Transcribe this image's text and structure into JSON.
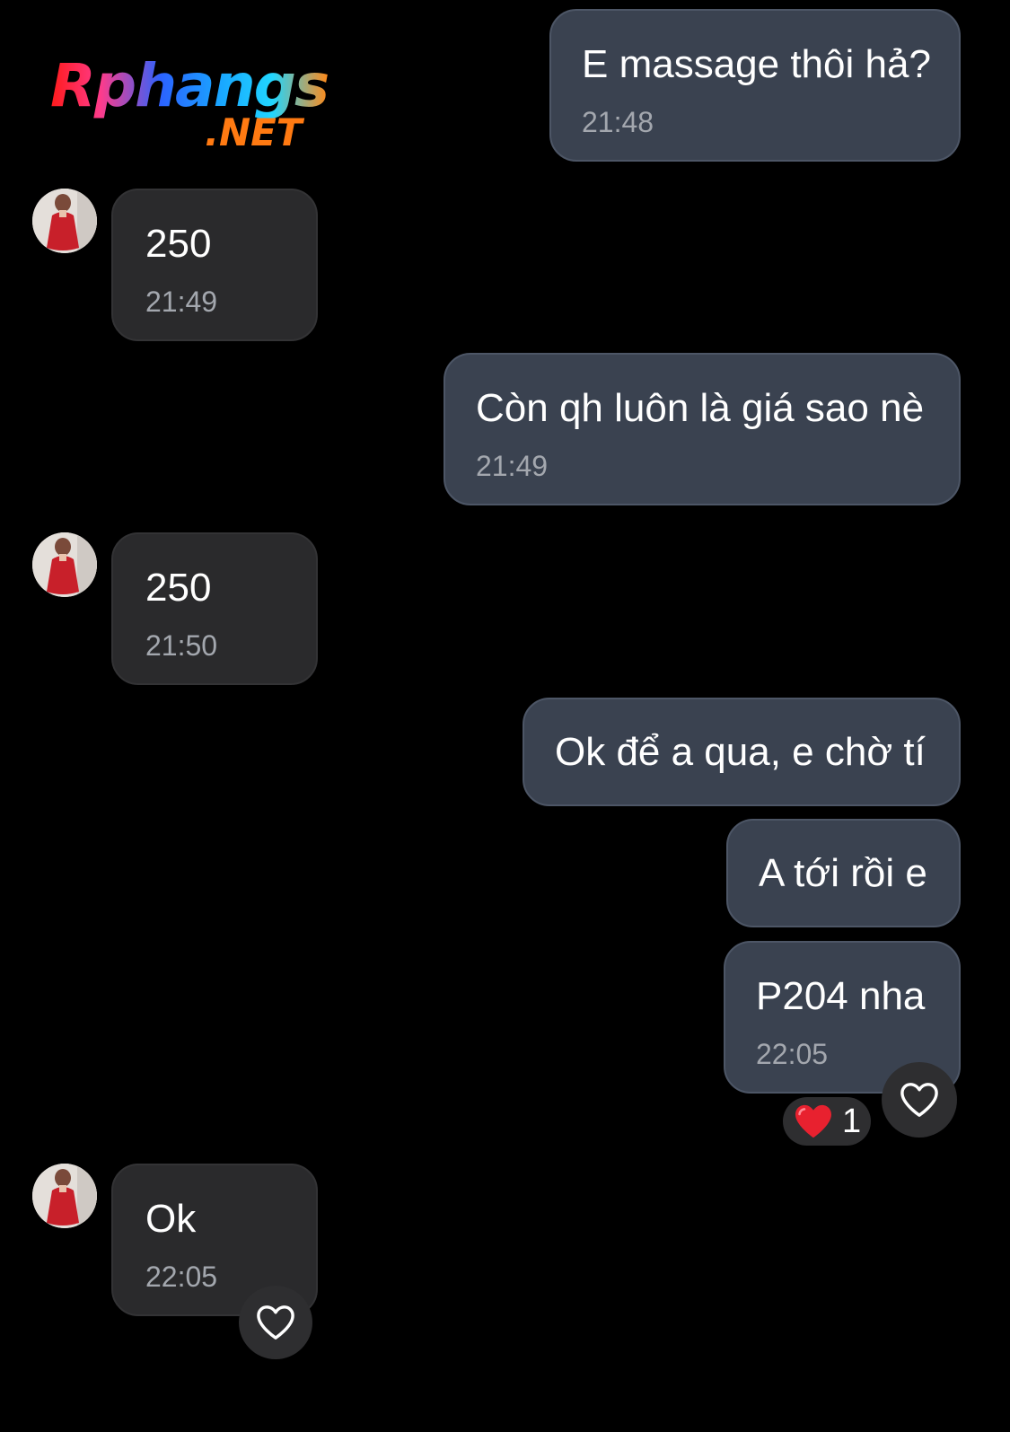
{
  "watermark": {
    "main": "Rphangs",
    "suffix": ".NET"
  },
  "colors": {
    "background": "#000000",
    "outgoing_bubble": "#3a4250",
    "incoming_bubble": "#2a2a2c",
    "timestamp": "#a3a7ae",
    "heart_reaction": "#e8212f"
  },
  "messages": [
    {
      "direction": "outgoing",
      "text": "E massage thôi hả?",
      "time": "21:48"
    },
    {
      "direction": "incoming",
      "text": "250",
      "time": "21:49",
      "avatar": "contact-avatar"
    },
    {
      "direction": "outgoing",
      "text": "Còn qh luôn là giá sao nè",
      "time": "21:49"
    },
    {
      "direction": "incoming",
      "text": "250",
      "time": "21:50",
      "avatar": "contact-avatar"
    },
    {
      "direction": "outgoing",
      "text": "Ok để a qua, e chờ tí",
      "time": ""
    },
    {
      "direction": "outgoing",
      "text": "A tới rồi e",
      "time": ""
    },
    {
      "direction": "outgoing",
      "text": "P204 nha",
      "time": "22:05",
      "reaction": {
        "icon": "red-heart-emoji",
        "count": "1"
      },
      "like_icon": "heart-outline-icon"
    },
    {
      "direction": "incoming",
      "text": "Ok",
      "time": "22:05",
      "avatar": "contact-avatar",
      "like_icon": "heart-outline-icon"
    }
  ]
}
